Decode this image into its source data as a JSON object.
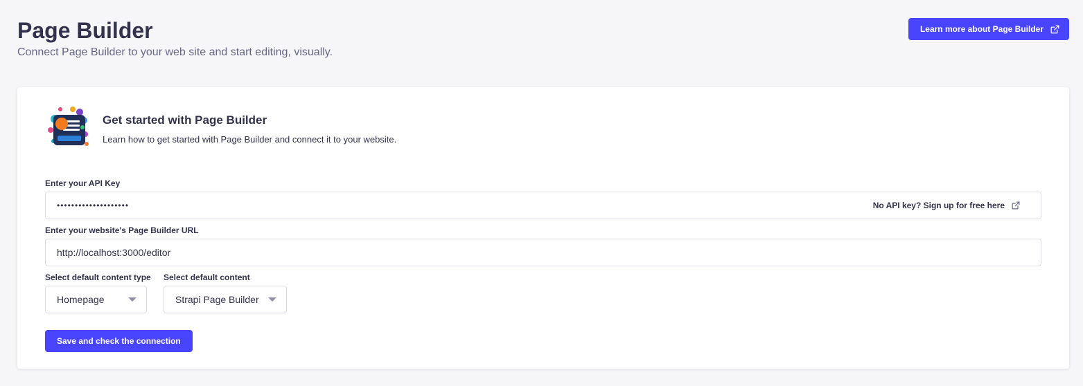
{
  "header": {
    "title": "Page Builder",
    "subtitle": "Connect Page Builder to your web site and start editing, visually.",
    "learn_more_label": "Learn more about Page Builder",
    "learn_more_icon": "external-link-icon"
  },
  "card": {
    "logo_icon": "page-builder-logo",
    "intro_title": "Get started with Page Builder",
    "intro_desc": "Learn how to get started with Page Builder and connect it to your website.",
    "api_key": {
      "label": "Enter your API Key",
      "value": "••••••••••••••••••••",
      "signup_label": "No API key? Sign up for free here",
      "signup_icon": "external-link-icon"
    },
    "url": {
      "label": "Enter your website's Page Builder URL",
      "value": "http://localhost:3000/editor"
    },
    "content_type": {
      "label": "Select default content type",
      "value": "Homepage"
    },
    "content": {
      "label": "Select default content",
      "value": "Strapi Page Builder"
    },
    "save_label": "Save and check the connection"
  },
  "colors": {
    "primary": "#4945ff",
    "background": "#f6f6f9",
    "text": "#32324d",
    "muted": "#666687",
    "border": "#dcdce4"
  }
}
